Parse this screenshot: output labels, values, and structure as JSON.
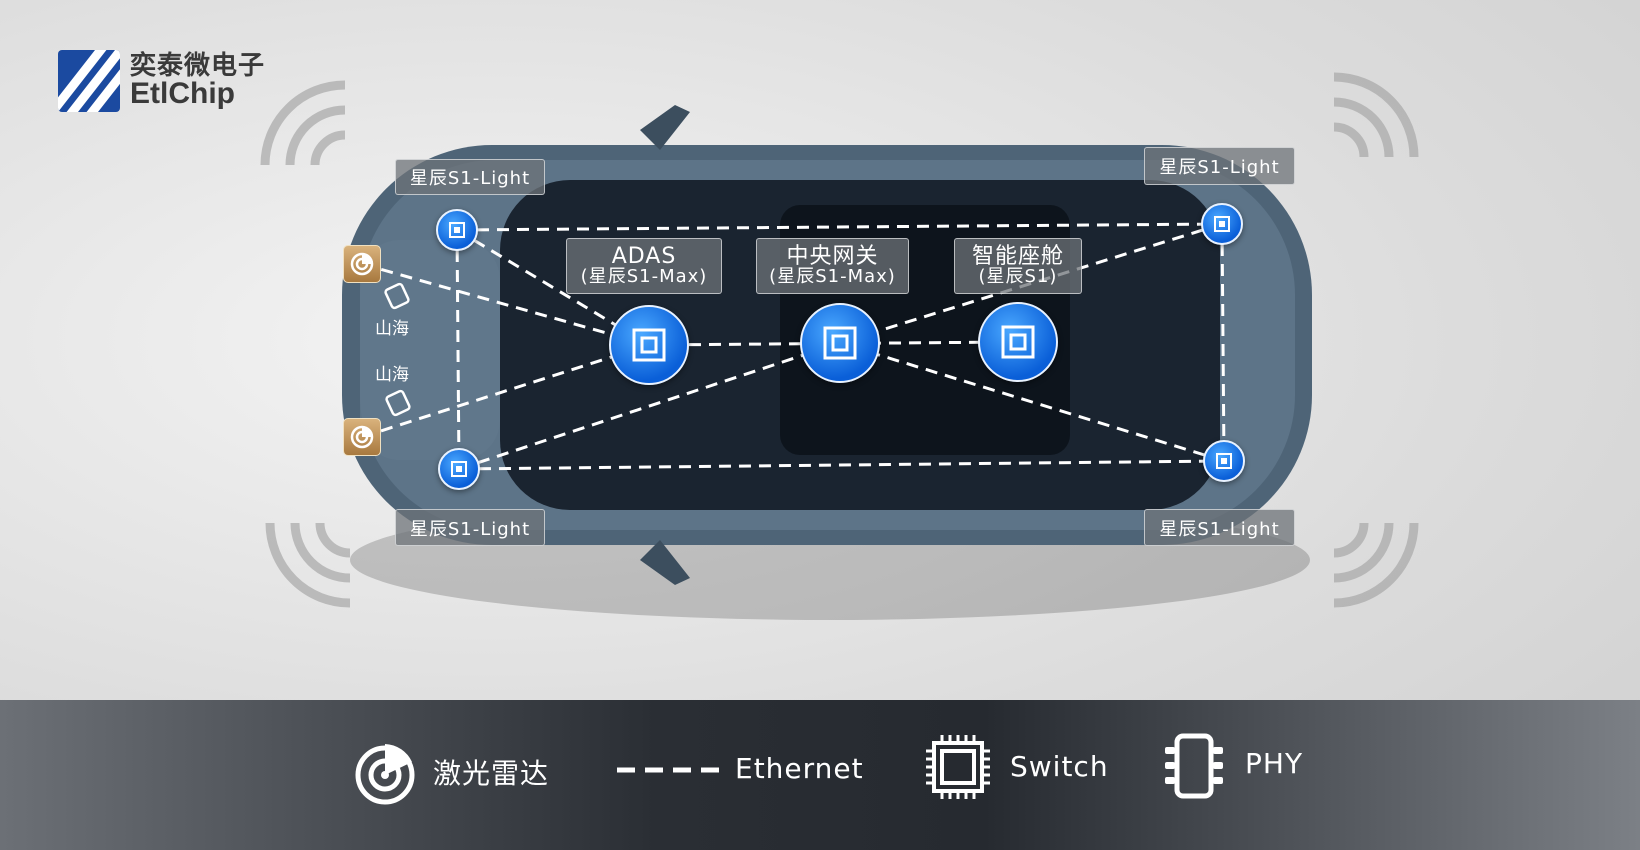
{
  "logo": {
    "cn": "奕泰微电子",
    "en": "EtlChip",
    "color": "#1b4aa0"
  },
  "labels": {
    "tl": "星辰S1-Light",
    "tr": "星辰S1-Light",
    "bl": "星辰S1-Light",
    "br": "星辰S1-Light"
  },
  "boxes": {
    "adas": {
      "t1": "ADAS",
      "t2": "(星辰S1-Max)"
    },
    "gateway": {
      "t1": "中央网关",
      "t2": "(星辰S1-Max)"
    },
    "cockpit": {
      "t1": "智能座舱",
      "t2": "(星辰S1)"
    }
  },
  "phy": {
    "top": "山海",
    "bottom": "山海"
  },
  "legend": {
    "lidar": "激光雷达",
    "ethernet": "Ethernet",
    "switch": "Switch",
    "phy": "PHY"
  },
  "colors": {
    "node": "#0a5fd8",
    "lidar": "#c09558",
    "band": "#2a2e34"
  }
}
